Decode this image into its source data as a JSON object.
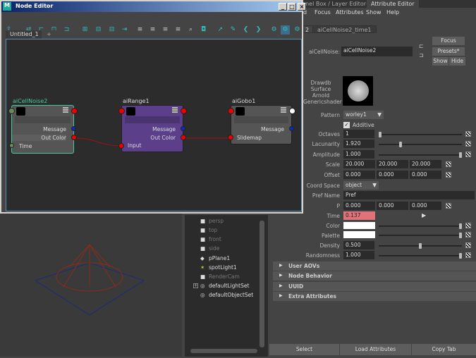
{
  "node_editor": {
    "title": "Node Editor",
    "window_buttons": [
      "_",
      "□",
      "×"
    ],
    "tabs": [
      "Untitled_1",
      "+"
    ],
    "nodes": [
      {
        "name": "aiCellNoise2",
        "ports": [
          "Message",
          "Out Color",
          "Time"
        ]
      },
      {
        "name": "aiRange1",
        "ports": [
          "Message",
          "Out Color",
          "Input"
        ]
      },
      {
        "name": "aiGobo1",
        "ports": [
          "Message",
          "Slidemap"
        ]
      }
    ]
  },
  "attribute_editor": {
    "panel_tabs": [
      "nnel Box / Layer Editor",
      "Attribute Editor"
    ],
    "menu": [
      "d",
      "Focus",
      "Attributes",
      "Show",
      "Help"
    ],
    "node_tabs": [
      "2",
      "aiCellNoise2_time1"
    ],
    "node_label": "aiCellNoise:",
    "node_name": "aiCellNoise2",
    "buttons": {
      "focus": "Focus",
      "presets": "Presets*",
      "show": "Show",
      "hide": "Hide"
    },
    "swatch_label": [
      "Drawdb",
      "Surface",
      "Arnold",
      "Genericshader"
    ],
    "pattern": {
      "label": "Pattern",
      "value": "worley1"
    },
    "additive": "Additive",
    "octaves": {
      "label": "Octaves",
      "value": "1",
      "slider": 0.0
    },
    "lacunarity": {
      "label": "Lacunarity",
      "value": "1.920",
      "slider": 0.25
    },
    "amplitude": {
      "label": "Amplitude",
      "value": "1.000",
      "slider": 1.0
    },
    "scale": {
      "label": "Scale",
      "values": [
        "20.000",
        "20.000",
        "20.000"
      ]
    },
    "offset": {
      "label": "Offset",
      "values": [
        "0.000",
        "0.000",
        "0.000"
      ]
    },
    "coord_space": {
      "label": "Coord Space",
      "value": "object"
    },
    "pref_name": {
      "label": "Pref Name",
      "value": "Pref"
    },
    "p": {
      "label": "P",
      "values": [
        "0.000",
        "0.000",
        "0.000"
      ]
    },
    "time": {
      "label": "Time",
      "value": "0.137"
    },
    "color": {
      "label": "Color",
      "slider": 1.0
    },
    "palette": {
      "label": "Palette",
      "slider": 1.0
    },
    "density": {
      "label": "Density",
      "value": "0.500",
      "slider": 0.5
    },
    "randomness": {
      "label": "Randomness",
      "value": "1.000",
      "slider": 1.0
    },
    "sections": [
      "User AOVs",
      "Node Behavior",
      "UUID",
      "Extra Attributes"
    ],
    "bottom": [
      "Select",
      "Load Attributes",
      "Copy Tab"
    ],
    "colors": {
      "time_bg": "#e0737a",
      "accent": "#46c8a0",
      "range_node": "#5b3f8a"
    }
  },
  "outliner": {
    "items": [
      "persp",
      "top",
      "front",
      "side",
      "pPlane1",
      "spotLight1",
      "RenderCam",
      "defaultLightSet",
      "defaultObjectSet"
    ]
  }
}
